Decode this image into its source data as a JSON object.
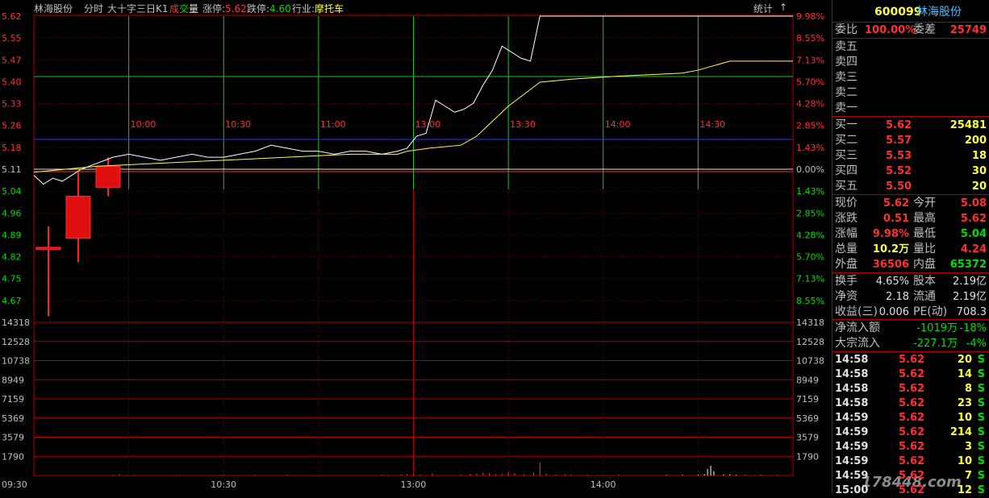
{
  "header": {
    "stock_name": "林海股份",
    "mode": "分时",
    "indicator": "大十字三日K1",
    "vol_prefix": "成",
    "vol_mid": "交",
    "vol_suffix": "量",
    "limit_up_label": "涨停:",
    "limit_up_value": "5.62",
    "limit_down_label": "跌停:",
    "limit_down_value": "4.60",
    "industry_label": "行业:",
    "industry_value": "摩托车",
    "stats_label": "统计",
    "arrow": "↑"
  },
  "price_axis": [
    "5.62",
    "5.55",
    "5.47",
    "5.40",
    "5.33",
    "5.26",
    "5.18",
    "5.11",
    "5.04",
    "4.96",
    "4.89",
    "4.82",
    "4.75",
    "4.67"
  ],
  "pct_axis": [
    "9.98%",
    "8.55%",
    "7.13%",
    "5.70%",
    "4.28%",
    "2.85%",
    "1.43%",
    "0.00%",
    "1.43%",
    "2.85%",
    "4.28%",
    "5.70%",
    "7.13%",
    "8.55%"
  ],
  "vol_axis": [
    "14318",
    "12528",
    "10738",
    "8949",
    "7159",
    "5369",
    "3579",
    "1790"
  ],
  "time_labels": [
    "09:30",
    "10:30",
    "13:00",
    "14:00"
  ],
  "inner_time_labels": [
    "10:00",
    "10:30",
    "11:00",
    "13:00",
    "13:30",
    "14:00",
    "14:30"
  ],
  "chart_data": {
    "type": "line",
    "prev_close": 5.11,
    "ylim": [
      4.6,
      5.62
    ],
    "x_range": [
      0,
      240
    ],
    "price_series": [
      [
        0,
        5.09
      ],
      [
        3,
        5.06
      ],
      [
        6,
        5.08
      ],
      [
        9,
        5.07
      ],
      [
        12,
        5.09
      ],
      [
        15,
        5.11
      ],
      [
        20,
        5.13
      ],
      [
        25,
        5.15
      ],
      [
        30,
        5.16
      ],
      [
        35,
        5.15
      ],
      [
        40,
        5.14
      ],
      [
        45,
        5.15
      ],
      [
        50,
        5.16
      ],
      [
        55,
        5.15
      ],
      [
        60,
        5.15
      ],
      [
        65,
        5.16
      ],
      [
        70,
        5.17
      ],
      [
        75,
        5.19
      ],
      [
        80,
        5.18
      ],
      [
        85,
        5.17
      ],
      [
        90,
        5.17
      ],
      [
        95,
        5.16
      ],
      [
        100,
        5.17
      ],
      [
        105,
        5.17
      ],
      [
        110,
        5.16
      ],
      [
        115,
        5.17
      ],
      [
        118,
        5.18
      ],
      [
        121,
        5.22
      ],
      [
        124,
        5.23
      ],
      [
        127,
        5.34
      ],
      [
        130,
        5.32
      ],
      [
        133,
        5.3
      ],
      [
        136,
        5.31
      ],
      [
        139,
        5.33
      ],
      [
        142,
        5.39
      ],
      [
        145,
        5.44
      ],
      [
        148,
        5.52
      ],
      [
        151,
        5.5
      ],
      [
        154,
        5.48
      ],
      [
        157,
        5.47
      ],
      [
        160,
        5.62
      ],
      [
        162,
        5.62
      ],
      [
        240,
        5.62
      ]
    ],
    "avg_series": [
      [
        0,
        5.1
      ],
      [
        20,
        5.12
      ],
      [
        40,
        5.13
      ],
      [
        60,
        5.14
      ],
      [
        80,
        5.15
      ],
      [
        100,
        5.16
      ],
      [
        115,
        5.16
      ],
      [
        118,
        5.17
      ],
      [
        125,
        5.18
      ],
      [
        135,
        5.19
      ],
      [
        140,
        5.22
      ],
      [
        145,
        5.27
      ],
      [
        150,
        5.32
      ],
      [
        155,
        5.36
      ],
      [
        160,
        5.4
      ],
      [
        170,
        5.41
      ],
      [
        185,
        5.42
      ],
      [
        205,
        5.43
      ],
      [
        210,
        5.44
      ],
      [
        220,
        5.47
      ],
      [
        240,
        5.47
      ]
    ],
    "kline": [
      {
        "open": 4.85,
        "close": 4.85,
        "high": 4.92,
        "low": 4.62
      },
      {
        "open": 4.88,
        "close": 5.02,
        "high": 5.1,
        "low": 4.8
      },
      {
        "open": 5.05,
        "close": 5.12,
        "high": 5.15,
        "low": 5.02
      }
    ],
    "volume_ylim": [
      0,
      14318
    ],
    "volume": [
      [
        10,
        5
      ],
      [
        25,
        60
      ],
      [
        27,
        120
      ],
      [
        32,
        40
      ],
      [
        45,
        50
      ],
      [
        60,
        80
      ],
      [
        70,
        60
      ],
      [
        80,
        70
      ],
      [
        95,
        30
      ],
      [
        110,
        70
      ],
      [
        112,
        50
      ],
      [
        116,
        90
      ],
      [
        118,
        130
      ],
      [
        120,
        90
      ],
      [
        122,
        60
      ],
      [
        126,
        200
      ],
      [
        135,
        90
      ],
      [
        138,
        140
      ],
      [
        140,
        180
      ],
      [
        142,
        250
      ],
      [
        144,
        200
      ],
      [
        146,
        120
      ],
      [
        148,
        160
      ],
      [
        150,
        300
      ],
      [
        152,
        220
      ],
      [
        155,
        120
      ],
      [
        158,
        260
      ],
      [
        160,
        1240
      ],
      [
        162,
        160
      ],
      [
        165,
        90
      ],
      [
        168,
        120
      ],
      [
        170,
        80
      ],
      [
        175,
        70
      ],
      [
        180,
        40
      ],
      [
        185,
        60
      ],
      [
        190,
        40
      ],
      [
        200,
        50
      ],
      [
        205,
        60
      ],
      [
        210,
        70
      ],
      [
        212,
        120
      ],
      [
        213,
        600
      ],
      [
        214,
        900
      ],
      [
        215,
        400
      ],
      [
        218,
        80
      ],
      [
        220,
        100
      ],
      [
        222,
        60
      ],
      [
        225,
        40
      ],
      [
        230,
        40
      ],
      [
        235,
        30
      ]
    ]
  },
  "side": {
    "code": "600099",
    "name": "林海股份",
    "weibi_label": "委比",
    "weibi_value": "100.00%",
    "weicha_label": "委差",
    "weicha_value": "25749",
    "sell": [
      {
        "label": "卖五"
      },
      {
        "label": "卖四"
      },
      {
        "label": "卖三"
      },
      {
        "label": "卖二"
      },
      {
        "label": "卖一"
      }
    ],
    "buy": [
      {
        "label": "买一",
        "price": "5.62",
        "vol": "25481"
      },
      {
        "label": "买二",
        "price": "5.57",
        "vol": "200"
      },
      {
        "label": "买三",
        "price": "5.53",
        "vol": "18"
      },
      {
        "label": "买四",
        "price": "5.52",
        "vol": "30"
      },
      {
        "label": "买五",
        "price": "5.50",
        "vol": "20"
      }
    ],
    "quote": [
      {
        "l1": "现价",
        "v1": "5.62",
        "l2": "今开",
        "v2": "5.08"
      },
      {
        "l1": "涨跌",
        "v1": "0.51",
        "l2": "最高",
        "v2": "5.62"
      },
      {
        "l1": "涨幅",
        "v1": "9.98%",
        "l2": "最低",
        "v2": "5.04"
      },
      {
        "l1": "总量",
        "v1": "10.2万",
        "l2": "量比",
        "v2": "4.24"
      },
      {
        "l1": "外盘",
        "v1": "36506",
        "l2": "内盘",
        "v2": "65372"
      }
    ],
    "fund": [
      {
        "l1": "换手",
        "v1": "4.65%",
        "l2": "股本",
        "v2": "2.19亿"
      },
      {
        "l1": "净资",
        "v1": "2.18",
        "l2": "流通",
        "v2": "2.19亿"
      },
      {
        "l1": "收益(三)",
        "v1": "0.006",
        "l2": "PE(动)",
        "v2": "708.3"
      }
    ],
    "flow": [
      {
        "label": "净流入额",
        "value": "-1019万",
        "pct": "-18%"
      },
      {
        "label": "大宗流入",
        "value": "-227.1万",
        "pct": "-4%"
      }
    ],
    "ticks": [
      {
        "time": "14:58",
        "price": "5.62",
        "vol": "20",
        "side": "S"
      },
      {
        "time": "14:58",
        "price": "5.62",
        "vol": "14",
        "side": "S"
      },
      {
        "time": "14:58",
        "price": "5.62",
        "vol": "8",
        "side": "S"
      },
      {
        "time": "14:58",
        "price": "5.62",
        "vol": "23",
        "side": "S"
      },
      {
        "time": "14:59",
        "price": "5.62",
        "vol": "10",
        "side": "S"
      },
      {
        "time": "14:59",
        "price": "5.62",
        "vol": "214",
        "side": "S"
      },
      {
        "time": "14:59",
        "price": "5.62",
        "vol": "3",
        "side": "S"
      },
      {
        "time": "14:59",
        "price": "5.62",
        "vol": "10",
        "side": "S"
      },
      {
        "time": "14:59",
        "price": "5.62",
        "vol": "7",
        "side": "S"
      },
      {
        "time": "15:00",
        "price": "5.62",
        "vol": "12",
        "side": "S"
      }
    ]
  },
  "watermark": "178448.com"
}
